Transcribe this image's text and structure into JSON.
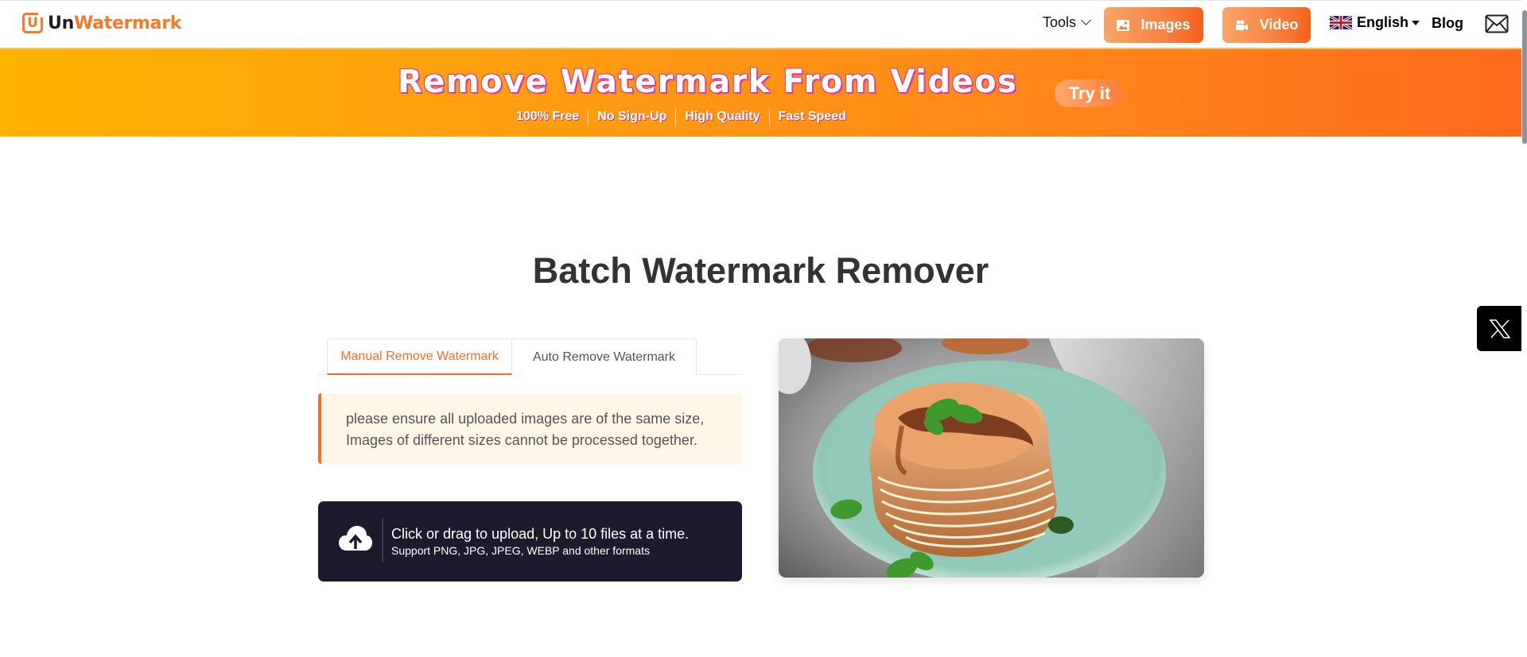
{
  "header": {
    "logo": {
      "prefix": "Un",
      "suffix": "Watermark",
      "icon_letter": "U"
    },
    "nav": {
      "tools_label": "Tools",
      "images_label": "Images",
      "video_label": "Video",
      "language_label": "English",
      "blog_label": "Blog"
    }
  },
  "banner": {
    "title": "Remove Watermark From Videos",
    "features": [
      "100% Free",
      "No Sign-Up",
      "High Quality",
      "Fast Speed"
    ],
    "cta_label": "Try it"
  },
  "main": {
    "title": "Batch Watermark Remover",
    "tabs": [
      {
        "label": "Manual Remove Watermark",
        "active": true
      },
      {
        "label": "Auto Remove Watermark",
        "active": false
      }
    ],
    "notice": {
      "line1": "please ensure all uploaded images are of the same size,",
      "line2": "Images of different sizes cannot be processed together."
    },
    "upload": {
      "main_text": "Click or drag to upload, Up to 10 files at a time.",
      "sub_text": "Support PNG, JPG, JPEG, WEBP and other formats"
    },
    "preview_image": {
      "description": "stack of pancakes with syrup and mint on a teal plate"
    }
  },
  "social": {
    "x_icon": "x-twitter-icon"
  },
  "colors": {
    "accent": "#f06e2a",
    "banner_start": "#ffb400",
    "banner_end": "#ff6a1e",
    "upload_bg": "#1c1b2e",
    "notice_bg": "#fff6e8"
  }
}
